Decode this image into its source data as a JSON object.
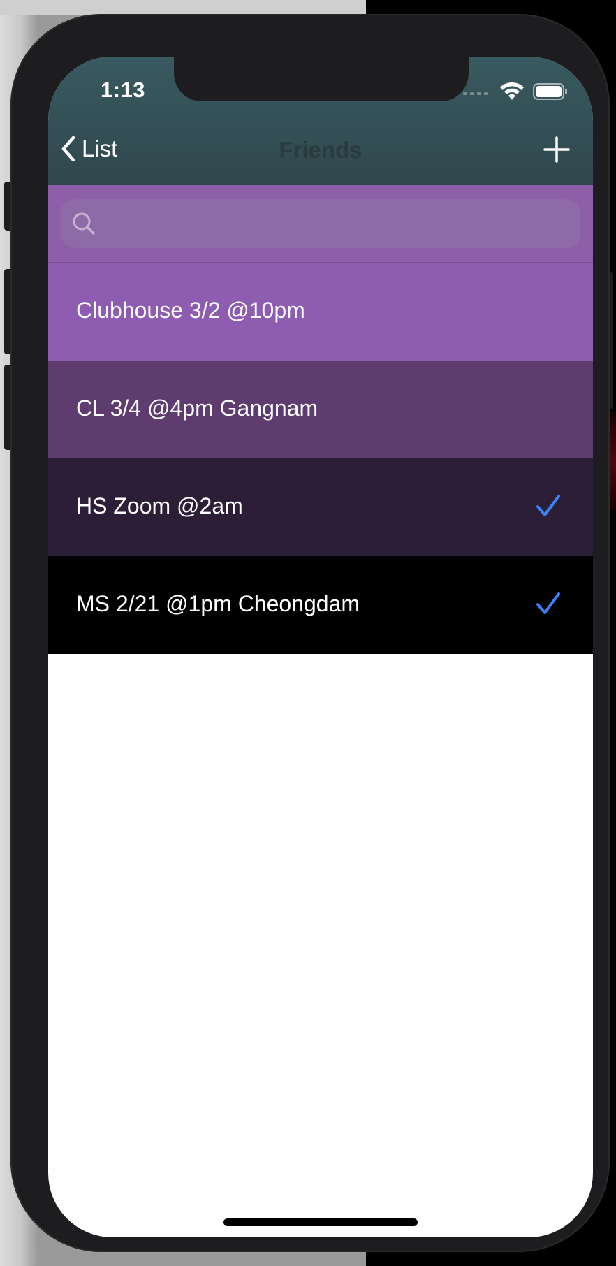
{
  "status_bar": {
    "time": "1:13"
  },
  "nav": {
    "back_label": "List",
    "title": "Friends",
    "add_icon": "plus-icon"
  },
  "search": {
    "placeholder": "",
    "value": ""
  },
  "items": [
    {
      "label": "Clubhouse 3/2 @10pm",
      "checked": false,
      "color": "#8e5cb0"
    },
    {
      "label": "CL 3/4 @4pm Gangnam",
      "checked": false,
      "color": "#5e3c70"
    },
    {
      "label": "HS Zoom @2am",
      "checked": true,
      "color": "#2c1e36"
    },
    {
      "label": "MS 2/21 @1pm Cheongdam",
      "checked": true,
      "color": "#000000"
    }
  ],
  "colors": {
    "nav_bar": "#33494f",
    "search_bar": "#8e5fa9",
    "checkmark": "#3b82f6"
  }
}
